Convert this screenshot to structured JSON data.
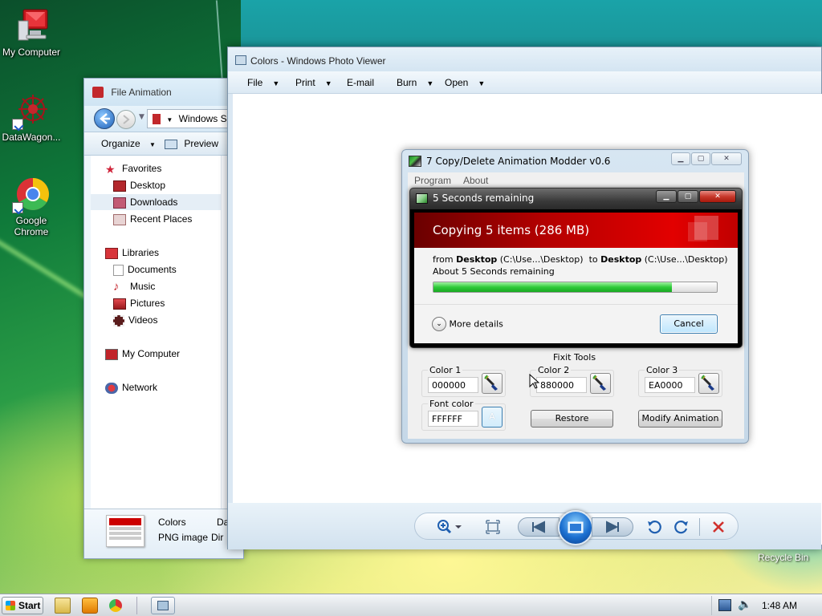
{
  "desktop": {
    "icons": [
      {
        "label": "My Computer"
      },
      {
        "label": "DataWagon..."
      },
      {
        "label": "Google Chrome"
      }
    ],
    "recycle_bin": "Recycle Bin"
  },
  "explorer": {
    "title": "File Animation",
    "address": "Windows S",
    "toolbar": {
      "organize": "Organize",
      "preview": "Preview"
    },
    "nav": {
      "favorites": "Favorites",
      "desktop": "Desktop",
      "downloads": "Downloads",
      "recent_places": "Recent Places",
      "libraries": "Libraries",
      "documents": "Documents",
      "music": "Music",
      "pictures": "Pictures",
      "videos": "Videos",
      "my_computer": "My Computer",
      "network": "Network"
    },
    "details": {
      "name": "Colors",
      "type": "PNG image",
      "col2a": "Da",
      "col2b": "Dir"
    }
  },
  "viewer": {
    "title": "Colors - Windows Photo Viewer",
    "menu": {
      "file": "File",
      "print": "Print",
      "email": "E-mail",
      "burn": "Burn",
      "open": "Open"
    }
  },
  "modder": {
    "title": "7 Copy/Delete Animation Modder v0.6",
    "menu": {
      "program": "Program",
      "about": "About"
    },
    "copy_dialog": {
      "title": "5 Seconds remaining",
      "heading": "Copying 5 items (286 MB)",
      "from_label": "from",
      "from_name": "Desktop",
      "from_path": "(C:\\Use...\\Desktop)",
      "to_label": "to",
      "to_name": "Desktop",
      "to_path": "(C:\\Use...\\Desktop)",
      "remaining": "About 5 Seconds remaining",
      "progress": 0.84,
      "more_details": "More details",
      "cancel": "Cancel"
    },
    "fixit": {
      "title": "Fixit Tools",
      "color1_label": "Color 1",
      "color1_value": "000000",
      "color2_label": "Color 2",
      "color2_value": "880000",
      "color3_label": "Color 3",
      "color3_value": "EA0000",
      "font_color_label": "Font color",
      "font_color_value": "FFFFFF",
      "restore": "Restore",
      "modify": "Modify Animation"
    }
  },
  "taskbar": {
    "start": "Start",
    "clock": "1:48 AM"
  },
  "colors": {
    "banner_red": "#c00000",
    "progress_green": "#2fcb3a",
    "close_red": "#d0312d"
  }
}
